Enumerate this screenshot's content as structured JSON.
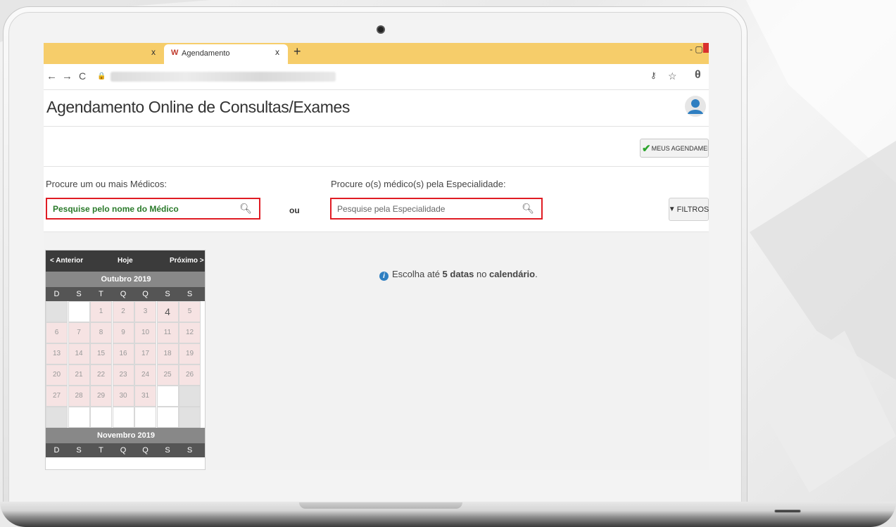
{
  "browser": {
    "prev_tab_close": "x",
    "active_tab": {
      "favicon": "W",
      "title": "Agendamento",
      "close": "x"
    },
    "new_tab": "+",
    "window_controls": "- ▢",
    "nav": {
      "back": "←",
      "forward": "→",
      "reload": "C",
      "lock": "🔒"
    },
    "addr_right": {
      "key": "⚷",
      "star": "☆",
      "account": "θ"
    }
  },
  "app": {
    "title": "Agendamento Online de Consultas/Exames",
    "meus_agendamentos": "MEUS AGENDAMENTOS",
    "medico_label": "Procure um ou mais Médicos:",
    "medico_placeholder": "Pesquise pelo nome do Médico",
    "ou": "ou",
    "especialidade_label": "Procure o(s) médico(s) pela Especialidade:",
    "especialidade_placeholder": "Pesquise pela Especialidade",
    "filtros": "FILTROS",
    "info": {
      "prefix": "Escolha até ",
      "strong1": "5 datas",
      "middle": " no ",
      "strong2": "calendário",
      "suffix": "."
    }
  },
  "calendar": {
    "prev": "< Anterior",
    "today": "Hoje",
    "next": "Próximo >",
    "weekdays": [
      "D",
      "S",
      "T",
      "Q",
      "Q",
      "S",
      "S"
    ],
    "months": [
      {
        "name": "Outubro 2019",
        "weeks": [
          [
            {
              "d": "",
              "s": "gray"
            },
            {
              "d": "",
              "s": "white"
            },
            {
              "d": "1",
              "s": "pink"
            },
            {
              "d": "2",
              "s": "pink"
            },
            {
              "d": "3",
              "s": "pink"
            },
            {
              "d": "4",
              "s": "today"
            },
            {
              "d": "5",
              "s": "pink"
            }
          ],
          [
            {
              "d": "6",
              "s": "pink"
            },
            {
              "d": "7",
              "s": "pink"
            },
            {
              "d": "8",
              "s": "pink"
            },
            {
              "d": "9",
              "s": "pink"
            },
            {
              "d": "10",
              "s": "pink"
            },
            {
              "d": "11",
              "s": "pink"
            },
            {
              "d": "12",
              "s": "pink"
            }
          ],
          [
            {
              "d": "13",
              "s": "pink"
            },
            {
              "d": "14",
              "s": "pink"
            },
            {
              "d": "15",
              "s": "pink"
            },
            {
              "d": "16",
              "s": "pink"
            },
            {
              "d": "17",
              "s": "pink"
            },
            {
              "d": "18",
              "s": "pink"
            },
            {
              "d": "19",
              "s": "pink"
            }
          ],
          [
            {
              "d": "20",
              "s": "pink"
            },
            {
              "d": "21",
              "s": "pink"
            },
            {
              "d": "22",
              "s": "pink"
            },
            {
              "d": "23",
              "s": "pink"
            },
            {
              "d": "24",
              "s": "pink"
            },
            {
              "d": "25",
              "s": "pink"
            },
            {
              "d": "26",
              "s": "pink"
            }
          ],
          [
            {
              "d": "27",
              "s": "pink"
            },
            {
              "d": "28",
              "s": "pink"
            },
            {
              "d": "29",
              "s": "pink"
            },
            {
              "d": "30",
              "s": "pink"
            },
            {
              "d": "31",
              "s": "pink"
            },
            {
              "d": "",
              "s": "white"
            },
            {
              "d": "",
              "s": "gray"
            }
          ],
          [
            {
              "d": "",
              "s": "gray"
            },
            {
              "d": "",
              "s": "white"
            },
            {
              "d": "",
              "s": "white"
            },
            {
              "d": "",
              "s": "white"
            },
            {
              "d": "",
              "s": "white"
            },
            {
              "d": "",
              "s": "white"
            },
            {
              "d": "",
              "s": "gray"
            }
          ]
        ]
      },
      {
        "name": "Novembro 2019"
      }
    ]
  },
  "colors": {
    "tabbar": "#f6cd6a",
    "highlight_border": "#e01c24",
    "green_placeholder": "#2a7a2a",
    "info_blue": "#2f7fc1"
  }
}
